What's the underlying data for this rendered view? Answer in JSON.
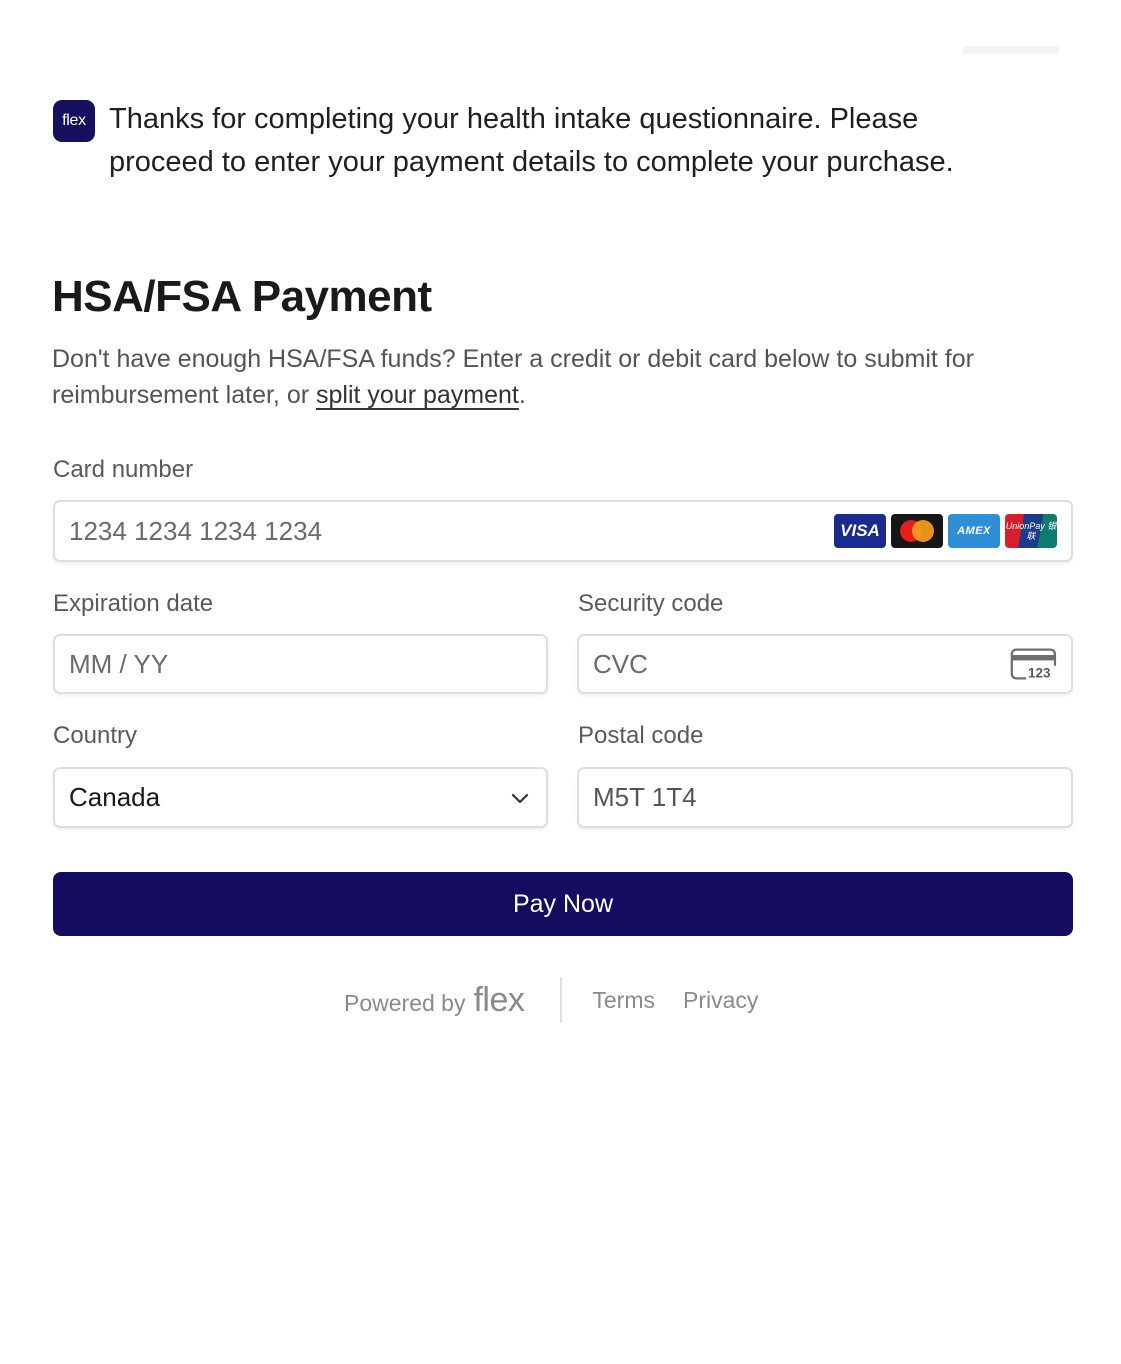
{
  "intro": {
    "logo_text": "flex",
    "message": "Thanks for completing your health intake questionnaire. Please proceed to enter your payment details to complete your purchase."
  },
  "payment": {
    "title": "HSA/FSA Payment",
    "description_prefix": "Don't have enough HSA/FSA funds? Enter a credit or debit card below to submit for reimbursement later, or ",
    "split_link": "split your payment",
    "description_suffix": "."
  },
  "form": {
    "card_number": {
      "label": "Card number",
      "placeholder": "1234 1234 1234 1234",
      "value": ""
    },
    "card_brands": [
      {
        "name": "visa-icon",
        "text": "VISA"
      },
      {
        "name": "mastercard-icon",
        "text": ""
      },
      {
        "name": "amex-icon",
        "text": "AMEX"
      },
      {
        "name": "unionpay-icon",
        "text": "UnionPay 银联"
      }
    ],
    "expiration": {
      "label": "Expiration date",
      "placeholder": "MM / YY",
      "value": ""
    },
    "security": {
      "label": "Security code",
      "placeholder": "CVC",
      "value": "",
      "icon_text": "123"
    },
    "country": {
      "label": "Country",
      "value": "Canada"
    },
    "postal": {
      "label": "Postal code",
      "value": "M5T 1T4"
    }
  },
  "actions": {
    "pay_label": "Pay Now"
  },
  "footer": {
    "powered_by": "Powered by",
    "brand": "flex",
    "terms": "Terms",
    "privacy": "Privacy"
  },
  "colors": {
    "brand_navy": "#130c60",
    "border": "#dedede",
    "muted_text": "#5a5a5a"
  }
}
